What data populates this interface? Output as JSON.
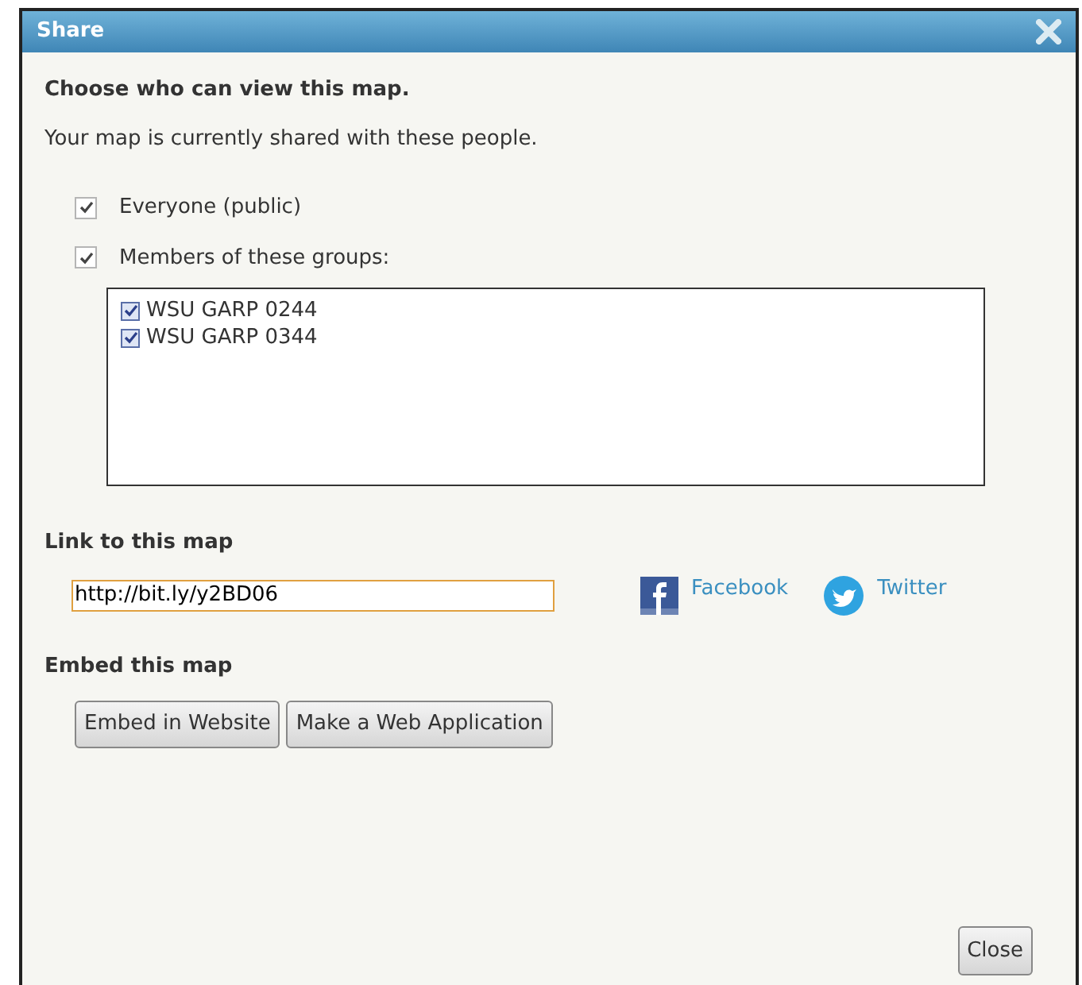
{
  "window": {
    "title": "Share"
  },
  "heading": "Choose who can view this map.",
  "subtitle": "Your map is currently shared with these people.",
  "options": [
    {
      "label": "Everyone (public)",
      "checked": true
    },
    {
      "label": "Members of these groups:",
      "checked": true
    }
  ],
  "groups": [
    {
      "label": "WSU GARP 0244",
      "checked": true
    },
    {
      "label": "WSU GARP 0344",
      "checked": true
    }
  ],
  "link_section": {
    "title": "Link to this map",
    "url": "http://bit.ly/y2BD06",
    "social": [
      {
        "kind": "facebook",
        "label": "Facebook"
      },
      {
        "kind": "twitter",
        "label": "Twitter"
      }
    ]
  },
  "embed_section": {
    "title": "Embed this map",
    "buttons": [
      "Embed in Website",
      "Make a Web Application"
    ]
  },
  "footer_button": "Close"
}
